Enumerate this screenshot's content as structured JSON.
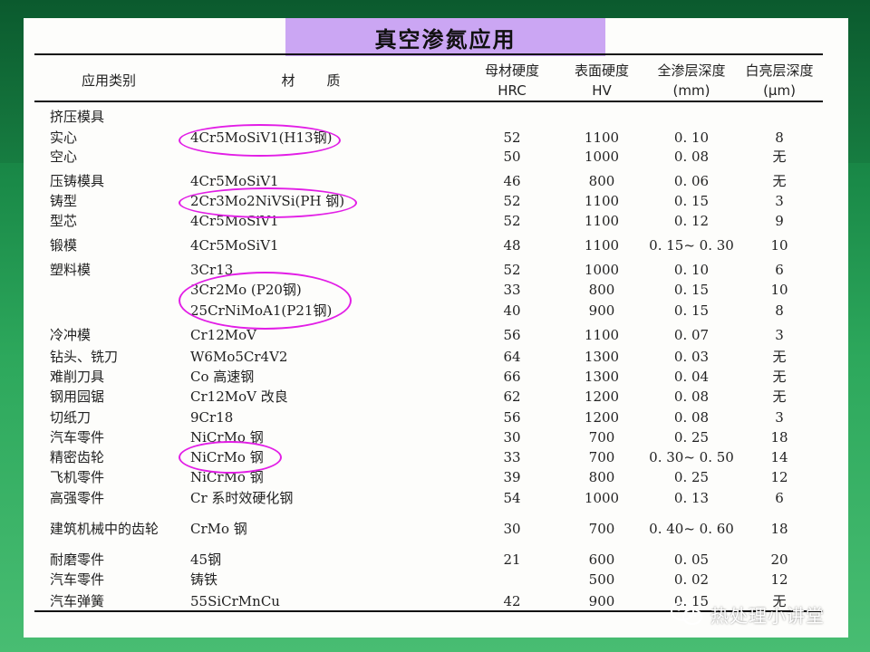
{
  "title": "真空渗氮应用",
  "headers": {
    "category": "应用类别",
    "material_a": "材",
    "material_b": "质",
    "base_hardness_1": "母材硬度",
    "base_hardness_2": "HRC",
    "surface_hardness_1": "表面硬度",
    "surface_hardness_2": "HV",
    "layer_depth_1": "全渗层深度",
    "layer_depth_2": "(mm)",
    "white_layer_1": "白亮层深度",
    "white_layer_2": "(μm)"
  },
  "rows": [
    {
      "category": "挤压模具",
      "material": "",
      "hrc": "",
      "hv": "",
      "depth": "",
      "white": ""
    },
    {
      "category": "实心",
      "material": "4Cr5MoSiV1(H13钢)",
      "hrc": "52",
      "hv": "1100",
      "depth": "0. 10",
      "white": "8"
    },
    {
      "category": "空心",
      "material": "",
      "hrc": "50",
      "hv": "1000",
      "depth": "0. 08",
      "white": "无"
    },
    {
      "category": "压铸模具",
      "material": "4Cr5MoSiV1",
      "hrc": "46",
      "hv": "800",
      "depth": "0. 06",
      "white": "无"
    },
    {
      "category": "铸型",
      "material": "2Cr3Mo2NiVSi(PH 钢)",
      "hrc": "52",
      "hv": "1100",
      "depth": "0. 15",
      "white": "3"
    },
    {
      "category": "型芯",
      "material": "4Cr5MoSiV1",
      "hrc": "52",
      "hv": "1100",
      "depth": "0. 12",
      "white": "9"
    },
    {
      "category": "锻模",
      "material": "4Cr5MoSiV1",
      "hrc": "48",
      "hv": "1100",
      "depth": "0. 15~ 0. 30",
      "white": "10"
    },
    {
      "category": "塑料模",
      "material": "3Cr13",
      "hrc": "52",
      "hv": "1000",
      "depth": "0. 10",
      "white": "6"
    },
    {
      "category": "",
      "material": "3Cr2Mo (P20钢)",
      "hrc": "33",
      "hv": "800",
      "depth": "0. 15",
      "white": "10"
    },
    {
      "category": "",
      "material": "25CrNiMoA1(P21钢)",
      "hrc": "40",
      "hv": "900",
      "depth": "0. 15",
      "white": "8"
    },
    {
      "category": "冷冲模",
      "material": "Cr12MoV",
      "hrc": "56",
      "hv": "1100",
      "depth": "0. 07",
      "white": "3"
    },
    {
      "category": "钻头、铣刀",
      "material": "W6Mo5Cr4V2",
      "hrc": "64",
      "hv": "1300",
      "depth": "0. 03",
      "white": "无"
    },
    {
      "category": "难削刀具",
      "material": "Co 高速钢",
      "hrc": "66",
      "hv": "1300",
      "depth": "0. 04",
      "white": "无"
    },
    {
      "category": "钢用园锯",
      "material": "Cr12MoV 改良",
      "hrc": "62",
      "hv": "1200",
      "depth": "0. 08",
      "white": "无"
    },
    {
      "category": "切纸刀",
      "material": "9Cr18",
      "hrc": "56",
      "hv": "1200",
      "depth": "0. 08",
      "white": "3"
    },
    {
      "category": "汽车零件",
      "material": "NiCrMo 钢",
      "hrc": "30",
      "hv": "700",
      "depth": "0. 25",
      "white": "18"
    },
    {
      "category": "精密齿轮",
      "material": "NiCrMo 钢",
      "hrc": "33",
      "hv": "700",
      "depth": "0. 30~ 0. 50",
      "white": "14"
    },
    {
      "category": "飞机零件",
      "material": "NiCrMo 钢",
      "hrc": "39",
      "hv": "800",
      "depth": "0. 25",
      "white": "12"
    },
    {
      "category": "高强零件",
      "material": "Cr 系时效硬化钢",
      "hrc": "54",
      "hv": "1000",
      "depth": "0. 13",
      "white": "6"
    },
    {
      "category": "建筑机械中的齿轮",
      "material": "CrMo 钢",
      "hrc": "30",
      "hv": "700",
      "depth": "0. 40~ 0. 60",
      "white": "18"
    },
    {
      "category": "耐磨零件",
      "material": "45钢",
      "hrc": "21",
      "hv": "600",
      "depth": "0. 05",
      "white": "20"
    },
    {
      "category": "汽车零件",
      "material": "铸铁",
      "hrc": "",
      "hv": "500",
      "depth": "0. 02",
      "white": "12"
    },
    {
      "category": "汽车弹簧",
      "material": "55SiCrMnCu",
      "hrc": "42",
      "hv": "900",
      "depth": "0. 15",
      "white": "无"
    }
  ],
  "watermark": "热处理小讲堂",
  "watermark_icon": "wechat-icon",
  "colors": {
    "title_bg": "#cba6f3",
    "highlight_oval": "#e21ee6",
    "background": "#1a8a48"
  }
}
